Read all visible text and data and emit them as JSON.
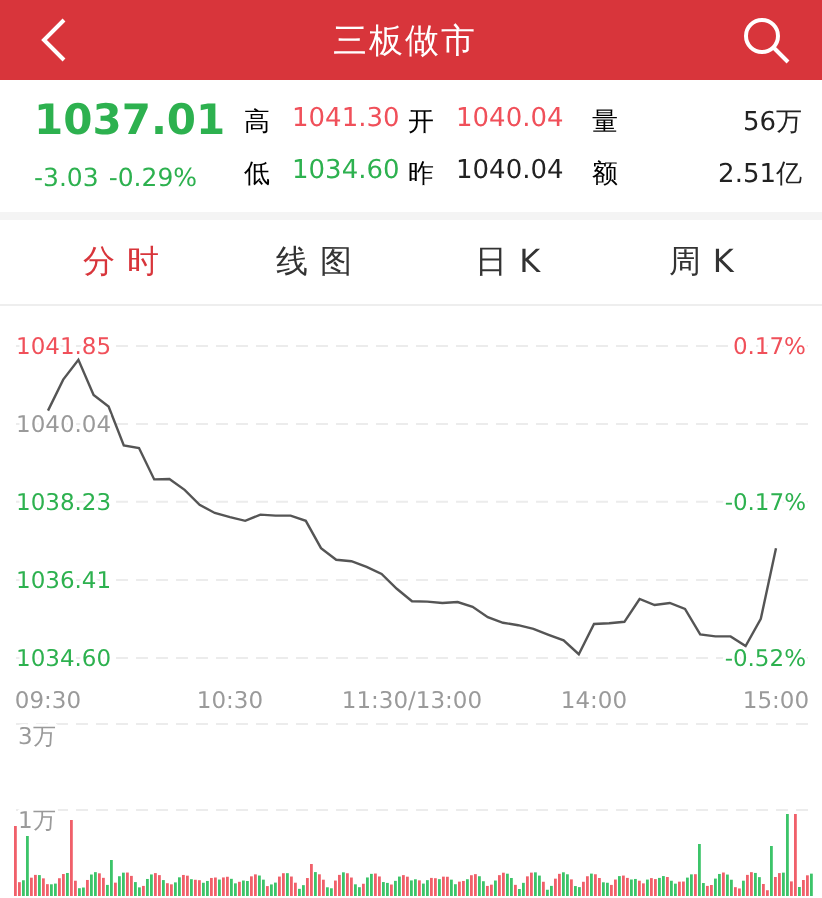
{
  "header": {
    "title": "三板做市"
  },
  "quote": {
    "price": {
      "text": "1037.01",
      "kind": "down"
    },
    "change": {
      "text": "-3.03",
      "kind": "down"
    },
    "change_pct": {
      "text": "-0.29%",
      "kind": "down"
    },
    "fields": [
      {
        "label": "高",
        "value": "1041.30",
        "kind": "up"
      },
      {
        "label": "开",
        "value": "1040.04",
        "kind": "up"
      },
      {
        "label": "量",
        "value": "56万",
        "kind": "flat"
      },
      {
        "label": "低",
        "value": "1034.60",
        "kind": "down"
      },
      {
        "label": "昨",
        "value": "1040.04",
        "kind": "flat"
      },
      {
        "label": "额",
        "value": "2.51亿",
        "kind": "flat"
      }
    ]
  },
  "tabs": [
    {
      "label": "分时",
      "selected": true
    },
    {
      "label": "线图",
      "selected": false
    },
    {
      "label": "日K",
      "selected": false
    },
    {
      "label": "周K",
      "selected": false
    }
  ],
  "chart": {
    "chart_data": {
      "type": "line",
      "categories": [
        "09:30",
        null,
        null,
        null,
        null,
        null,
        null,
        null,
        null,
        null,
        null,
        null,
        "10:30",
        null,
        null,
        null,
        null,
        null,
        null,
        null,
        null,
        null,
        null,
        null,
        "11:30/13:00",
        null,
        null,
        null,
        null,
        null,
        null,
        null,
        null,
        null,
        null,
        null,
        "14:00",
        null,
        null,
        null,
        null,
        null,
        null,
        null,
        null,
        null,
        null,
        null,
        "15:00"
      ],
      "series": [
        {
          "color": "#555555",
          "values": [
            1040.35,
            1041.07,
            1041.53,
            1040.71,
            1040.44,
            1039.54,
            1039.48,
            1038.75,
            1038.76,
            1038.51,
            1038.16,
            1037.97,
            1037.87,
            1037.79,
            1037.93,
            1037.91,
            1037.91,
            1037.79,
            1037.15,
            1036.88,
            1036.85,
            1036.72,
            1036.55,
            1036.21,
            1035.92,
            1035.91,
            1035.88,
            1035.9,
            1035.79,
            1035.55,
            1035.42,
            1035.36,
            1035.28,
            1035.14,
            1035.01,
            1034.69,
            1035.39,
            1035.41,
            1035.44,
            1035.97,
            1035.83,
            1035.88,
            1035.74,
            1035.15,
            1035.1,
            1035.1,
            1034.88,
            1035.51,
            1037.15
          ]
        }
      ],
      "ylim": [
        1034.6,
        1041.85
      ],
      "grid": true,
      "yticks": [
        {
          "value": 1041.85,
          "label": "1041.85"
        },
        {
          "value": 1040.04,
          "label": "1040.04"
        },
        {
          "value": 1038.23,
          "label": "1038.23"
        },
        {
          "value": 1036.41,
          "label": "1036.41"
        },
        {
          "value": 1034.6,
          "label": "1034.60"
        }
      ]
    },
    "price_label_styles": [
      {
        "kind": "up"
      },
      {
        "kind": "flat"
      },
      {
        "kind": "down"
      },
      {
        "kind": "down"
      },
      {
        "kind": "down"
      }
    ],
    "pct_labels": [
      {
        "text": "0.17%",
        "kind": "up"
      },
      {
        "text": "-0.17%",
        "kind": "down"
      },
      {
        "text": "-0.52%",
        "kind": "down"
      }
    ],
    "volume_labels": [
      "3万",
      "1万"
    ]
  }
}
